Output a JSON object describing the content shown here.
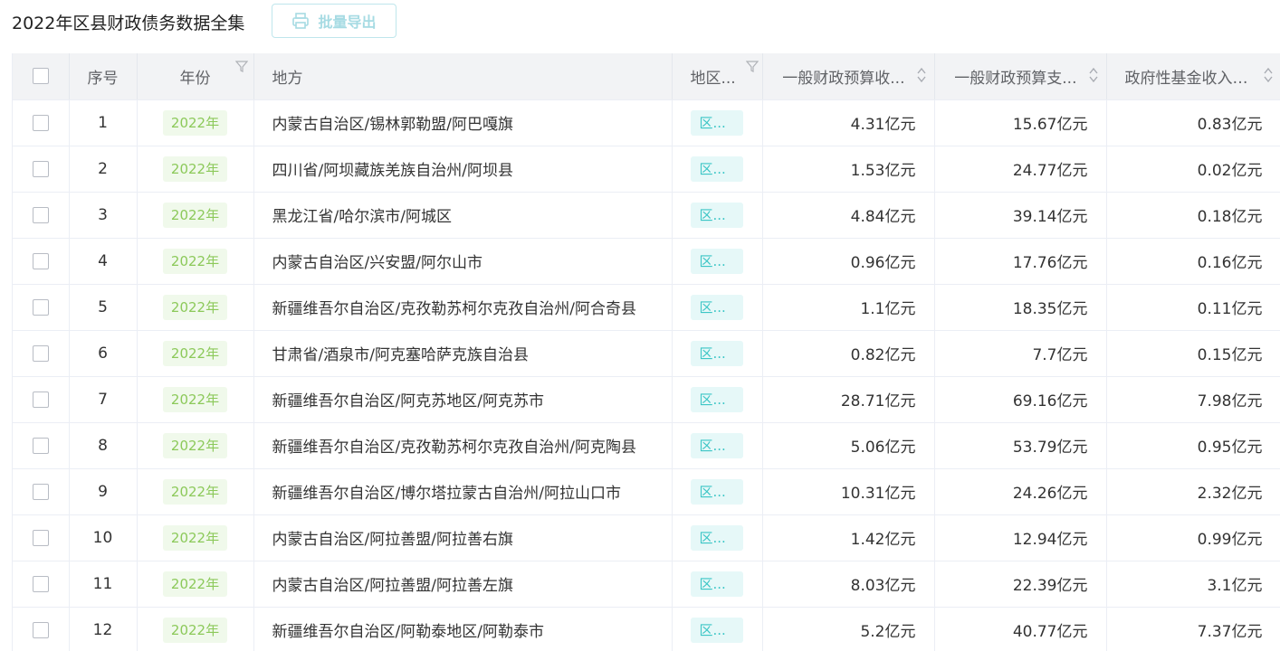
{
  "header": {
    "title": "2022年区县财政债务数据全集",
    "export_label": "批量导出"
  },
  "colors": {
    "accent": "#3cc6c6",
    "year_tag_text": "#8cc95a",
    "year_tag_bg": "#f0f9eb",
    "header_bg": "#f2f3f5"
  },
  "table": {
    "columns": {
      "index": "序号",
      "year": "年份",
      "region": "地方",
      "type": "地区...",
      "general_income": "一般财政预算收...",
      "general_expense": "一般财政预算支...",
      "fund_income": "政府性基金收入(..."
    },
    "rows": [
      {
        "index": "1",
        "year": "2022年",
        "region": "内蒙古自治区/锡林郭勒盟/阿巴嘎旗",
        "type": "区...",
        "income": "4.31亿元",
        "expense": "15.67亿元",
        "fund": "0.83亿元"
      },
      {
        "index": "2",
        "year": "2022年",
        "region": "四川省/阿坝藏族羌族自治州/阿坝县",
        "type": "区...",
        "income": "1.53亿元",
        "expense": "24.77亿元",
        "fund": "0.02亿元"
      },
      {
        "index": "3",
        "year": "2022年",
        "region": "黑龙江省/哈尔滨市/阿城区",
        "type": "区...",
        "income": "4.84亿元",
        "expense": "39.14亿元",
        "fund": "0.18亿元"
      },
      {
        "index": "4",
        "year": "2022年",
        "region": "内蒙古自治区/兴安盟/阿尔山市",
        "type": "区...",
        "income": "0.96亿元",
        "expense": "17.76亿元",
        "fund": "0.16亿元"
      },
      {
        "index": "5",
        "year": "2022年",
        "region": "新疆维吾尔自治区/克孜勒苏柯尔克孜自治州/阿合奇县",
        "type": "区...",
        "income": "1.1亿元",
        "expense": "18.35亿元",
        "fund": "0.11亿元"
      },
      {
        "index": "6",
        "year": "2022年",
        "region": "甘肃省/酒泉市/阿克塞哈萨克族自治县",
        "type": "区...",
        "income": "0.82亿元",
        "expense": "7.7亿元",
        "fund": "0.15亿元"
      },
      {
        "index": "7",
        "year": "2022年",
        "region": "新疆维吾尔自治区/阿克苏地区/阿克苏市",
        "type": "区...",
        "income": "28.71亿元",
        "expense": "69.16亿元",
        "fund": "7.98亿元"
      },
      {
        "index": "8",
        "year": "2022年",
        "region": "新疆维吾尔自治区/克孜勒苏柯尔克孜自治州/阿克陶县",
        "type": "区...",
        "income": "5.06亿元",
        "expense": "53.79亿元",
        "fund": "0.95亿元"
      },
      {
        "index": "9",
        "year": "2022年",
        "region": "新疆维吾尔自治区/博尔塔拉蒙古自治州/阿拉山口市",
        "type": "区...",
        "income": "10.31亿元",
        "expense": "24.26亿元",
        "fund": "2.32亿元"
      },
      {
        "index": "10",
        "year": "2022年",
        "region": "内蒙古自治区/阿拉善盟/阿拉善右旗",
        "type": "区...",
        "income": "1.42亿元",
        "expense": "12.94亿元",
        "fund": "0.99亿元"
      },
      {
        "index": "11",
        "year": "2022年",
        "region": "内蒙古自治区/阿拉善盟/阿拉善左旗",
        "type": "区...",
        "income": "8.03亿元",
        "expense": "22.39亿元",
        "fund": "3.1亿元"
      },
      {
        "index": "12",
        "year": "2022年",
        "region": "新疆维吾尔自治区/阿勒泰地区/阿勒泰市",
        "type": "区...",
        "income": "5.2亿元",
        "expense": "40.77亿元",
        "fund": "7.37亿元"
      }
    ]
  }
}
